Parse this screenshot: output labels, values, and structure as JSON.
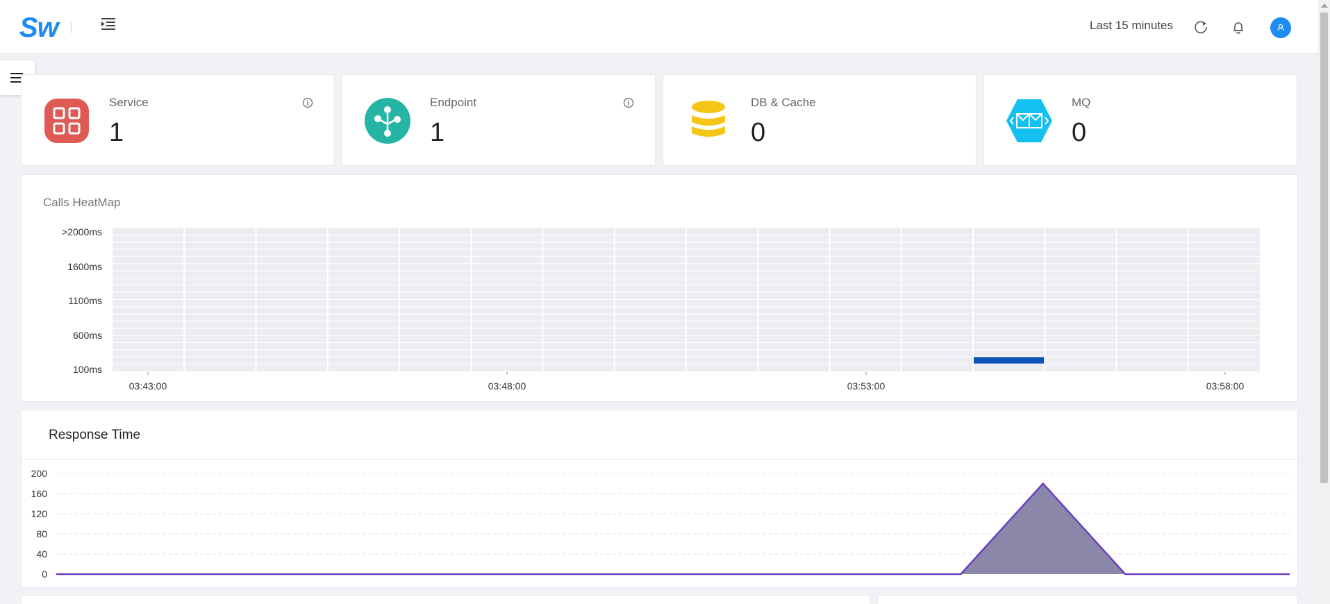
{
  "header": {
    "logo": "Sw",
    "time_range": "Last 15 minutes",
    "icons": [
      "menu-fold-icon",
      "refresh-icon",
      "bell-icon",
      "user-icon"
    ]
  },
  "stats": [
    {
      "label": "Service",
      "value": "1",
      "icon": "apps-grid-icon",
      "color": "#e05a55",
      "info": true
    },
    {
      "label": "Endpoint",
      "value": "1",
      "icon": "endpoint-nodes-icon",
      "color": "#26b5a5",
      "info": true
    },
    {
      "label": "DB & Cache",
      "value": "0",
      "icon": "database-icon",
      "color": "#f5c518",
      "info": false
    },
    {
      "label": "MQ",
      "value": "0",
      "icon": "message-queue-icon",
      "color": "#13c0f0",
      "info": false
    }
  ],
  "heatmap": {
    "title": "Calls HeatMap",
    "y_labels": [
      ">2000ms",
      "1600ms",
      "1100ms",
      "600ms",
      "100ms"
    ],
    "x_labels": [
      "03:43:00",
      "03:48:00",
      "03:53:00",
      "03:58:00"
    ],
    "accent": "#0d55b8"
  },
  "response_time": {
    "title": "Response Time"
  },
  "chart_data": [
    {
      "type": "heatmap",
      "title": "Calls HeatMap",
      "y_categories": [
        "100ms",
        "600ms",
        "1100ms",
        "1600ms",
        ">2000ms"
      ],
      "x_categories": [
        "03:43:00",
        "03:48:00",
        "03:53:00",
        "03:58:00"
      ],
      "columns": 16,
      "rows": 20,
      "cells": [
        {
          "column": 12,
          "row": 1,
          "value": 1
        }
      ],
      "color": "#0d55b8"
    },
    {
      "type": "area",
      "title": "Response Time",
      "x": [
        0,
        1,
        2,
        3,
        4,
        5,
        6,
        7,
        8,
        9,
        10,
        11,
        12,
        13,
        14,
        15
      ],
      "values": [
        0,
        0,
        0,
        0,
        0,
        0,
        0,
        0,
        0,
        0,
        0,
        0,
        180,
        0,
        0,
        0
      ],
      "ylim": [
        0,
        200
      ],
      "yticks": [
        0,
        40,
        80,
        120,
        160,
        200
      ],
      "line_color": "#6b3fc4",
      "fill_color": "#8a87a8",
      "grid": true
    }
  ]
}
